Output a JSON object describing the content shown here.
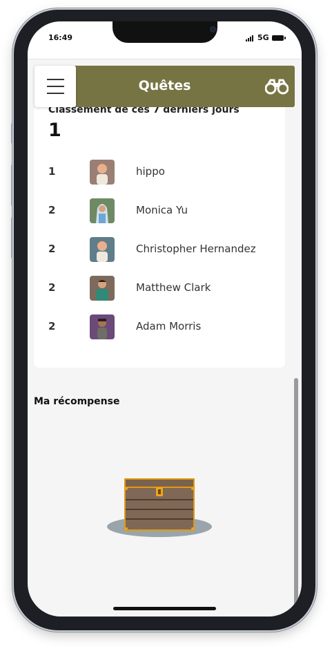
{
  "status": {
    "time": "16:49",
    "network": "5G"
  },
  "header": {
    "title": "Quêtes",
    "menu_icon": "hamburger-icon",
    "action_icon": "binoculars-icon",
    "color": "#777444"
  },
  "leaderboard": {
    "title": "Classement de ces 7 derniers jours",
    "my_rank": "1",
    "rows": [
      {
        "rank": "1",
        "name": "hippo",
        "avatar": "avatar-icon"
      },
      {
        "rank": "2",
        "name": "Monica Yu",
        "avatar": "avatar-icon"
      },
      {
        "rank": "2",
        "name": "Christopher Hernandez",
        "avatar": "avatar-icon"
      },
      {
        "rank": "2",
        "name": "Matthew Clark",
        "avatar": "avatar-icon"
      },
      {
        "rank": "2",
        "name": "Adam Morris",
        "avatar": "avatar-icon"
      }
    ]
  },
  "reward": {
    "title": "Ma récompense",
    "icon": "treasure-chest-icon"
  }
}
